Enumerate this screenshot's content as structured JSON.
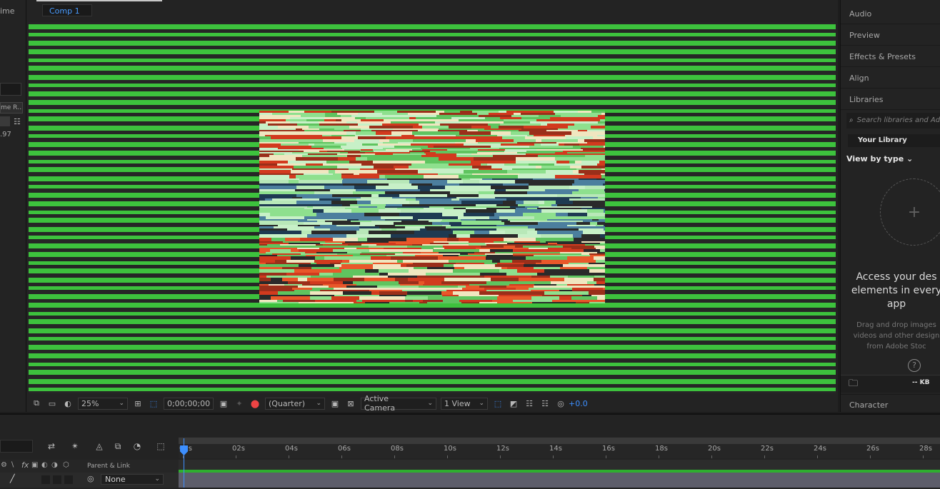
{
  "left_panel": {
    "title_fragment": "ime",
    "column_fragment": "me R...",
    "value_fragment": ".97"
  },
  "viewer": {
    "comp_tab": "Comp 1"
  },
  "toolbar": {
    "zoom": "25%",
    "timecode": "0;00;00;00",
    "resolution": "(Quarter)",
    "camera": "Active Camera",
    "views": "1 View",
    "exposure": "+0.0"
  },
  "panels": {
    "items": [
      "Audio",
      "Preview",
      "Effects & Presets",
      "Align",
      "Libraries"
    ],
    "character": "Character"
  },
  "libraries": {
    "search_placeholder": "Search libraries and Adobe",
    "your_library": "Your Library",
    "view_by": "View by type",
    "heading_line1": "Access your des",
    "heading_line2": "elements in every",
    "heading_line3": "app",
    "sub_line1": "Drag and drop images",
    "sub_line2": "videos and other design",
    "sub_line3": "from Adobe Stoc",
    "help": "?",
    "size": "-- KB"
  },
  "timeline": {
    "ticks": [
      "00s",
      "02s",
      "04s",
      "06s",
      "08s",
      "10s",
      "12s",
      "14s",
      "16s",
      "18s",
      "20s",
      "22s",
      "24s",
      "26s",
      "28s"
    ],
    "header_fx": "fx",
    "parent_link": "Parent & Link",
    "parent_value": "None"
  },
  "colors": {
    "green": "#3dc23d",
    "accent_blue": "#3d8fff"
  }
}
